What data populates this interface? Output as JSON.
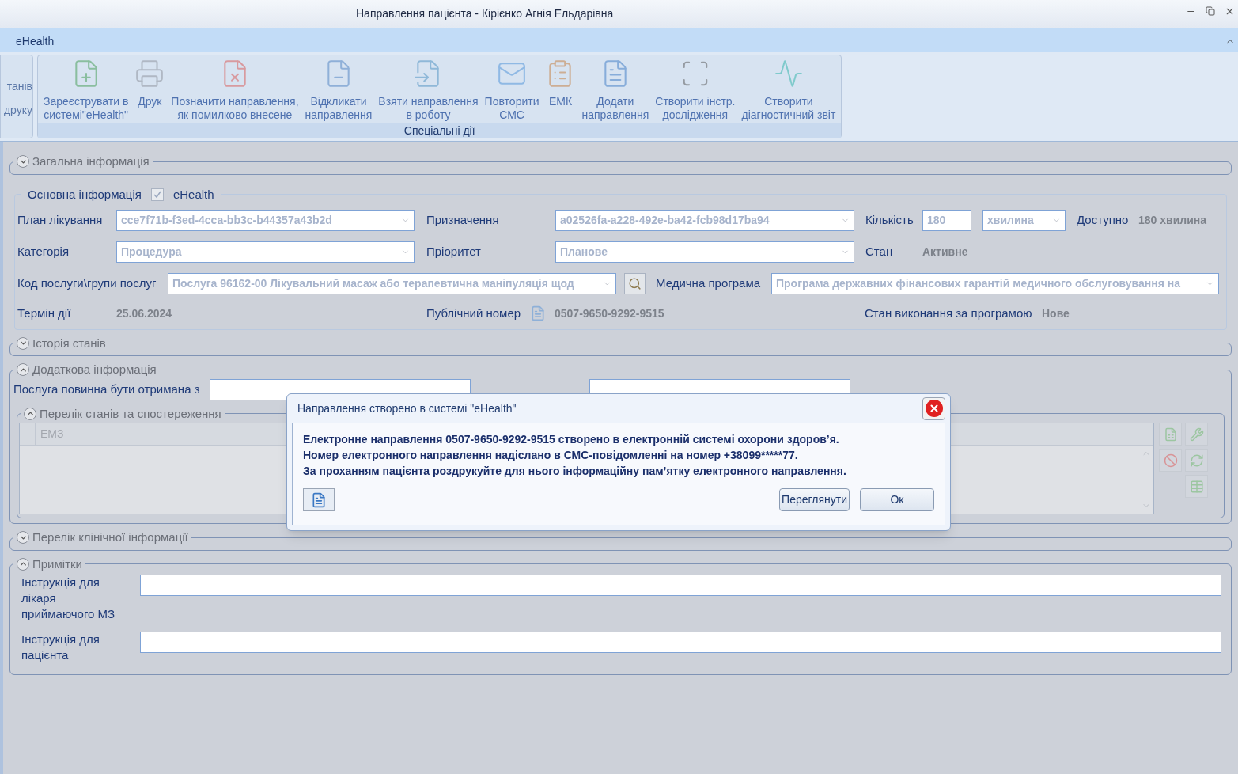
{
  "window": {
    "title": "Направлення пацієнта - Кірієнко Агнія Ельдарівна"
  },
  "menu": [
    {
      "label": "eHealth",
      "selected": true
    }
  ],
  "ribbon": {
    "cut_group": [
      "танів",
      "друку"
    ],
    "group": {
      "title": "Спеціальні дії",
      "buttons": [
        {
          "label": "Зареєструвати в\nсистемі\"eHealth\"",
          "disabled": true
        },
        {
          "label": "Друк",
          "disabled": true
        },
        {
          "label": "Позначити направлення,\nяк помилково внесене",
          "disabled": true
        },
        {
          "label": "Відкликати\nнаправлення",
          "disabled": true
        },
        {
          "label": "Взяти направлення\nв роботу",
          "disabled": true
        },
        {
          "label": "Повторити\nСМС",
          "disabled": true
        },
        {
          "label": "ЕМК",
          "disabled": true
        },
        {
          "label": "Додати\nнаправлення",
          "disabled": true
        },
        {
          "label": "Створити інстр.\nдослідження",
          "disabled": true
        },
        {
          "label": "Створити\nдіагностичний звіт",
          "disabled": true
        }
      ]
    }
  },
  "general": {
    "title": "Загальна інформація",
    "expanded": false
  },
  "main_info": {
    "title": "Основна інформація",
    "ehealth_checkbox": {
      "label": "eHealth",
      "checked": true
    },
    "plan": {
      "label": "План лікування",
      "value": "cce7f71b-f3ed-4cca-bb3c-b44357a43b2d"
    },
    "assignment": {
      "label": "Призначення",
      "value": "a02526fa-a228-492e-ba42-fcb98d17ba94"
    },
    "quantity": {
      "label": "Кількість",
      "value": "180",
      "unit": "хвилина"
    },
    "available": {
      "label": "Доступно",
      "value": "180 хвилина"
    },
    "category": {
      "label": "Категорія",
      "value": "Процедура"
    },
    "priority": {
      "label": "Пріоритет",
      "value": "Планове"
    },
    "status": {
      "label": "Стан",
      "value": "Активне"
    },
    "service": {
      "label": "Код послуги\\групи послуг",
      "value": "Послуга 96162-00 Лікувальний масаж або терапевтична маніпуляція щод"
    },
    "program": {
      "label": "Медична програма",
      "value": "Програма державних фінансових гарантій медичного обслуговування на"
    },
    "term": {
      "label": "Термін дії",
      "value": "25.06.2024"
    },
    "public_number": {
      "label": "Публічний номер",
      "value": "0507-9650-9292-9515"
    },
    "program_status": {
      "label": "Стан виконання за програмою",
      "value": "Нове"
    }
  },
  "history": {
    "title": "Історія станів",
    "expanded": false
  },
  "additional": {
    "title": "Додаткова інформація",
    "expanded": true,
    "service_from_label": "Послуга повинна бути отримана з",
    "conditions": {
      "title": "Перелік станів та спостереження",
      "expanded": true,
      "columns": [
        "ЕМЗ"
      ]
    }
  },
  "clinical": {
    "title": "Перелік клінічної інформації",
    "expanded": false
  },
  "notes": {
    "title": "Примітки",
    "expanded": true,
    "fields": [
      {
        "label": "Інструкція для лікаря приймаючого МЗ"
      },
      {
        "label": "Інструкція для пацієнта"
      }
    ]
  },
  "dialog": {
    "title": "Направлення створено в системі \"eHealth\"",
    "lines": [
      "Електронне направлення 0507-9650-9292-9515 створено в електронній системі охорони здоровʼя.",
      "Номер електронного направлення надіслано в СМС-повідомленні на номер +38099*****77.",
      "За проханням пацієнта роздрукуйте для нього інформаційну памʼятку електронного направлення."
    ],
    "buttons": [
      "Переглянути",
      "Ок"
    ]
  }
}
